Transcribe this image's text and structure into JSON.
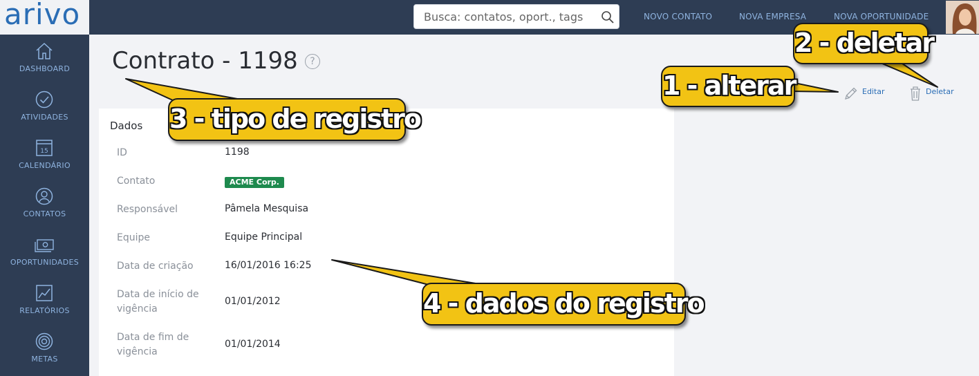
{
  "app": {
    "logo_text": "arivo"
  },
  "header": {
    "search_placeholder": "Busca: contatos, oport., tags",
    "links": [
      "NOVO CONTATO",
      "NOVA EMPRESA",
      "NOVA OPORTUNIDADE"
    ]
  },
  "sidebar": {
    "items": [
      {
        "label": "DASHBOARD",
        "icon": "home-icon"
      },
      {
        "label": "ATIVIDADES",
        "icon": "check-circle-icon"
      },
      {
        "label": "CALENDÁRIO",
        "icon": "calendar-icon",
        "day": "15"
      },
      {
        "label": "CONTATOS",
        "icon": "user-icon"
      },
      {
        "label": "OPORTUNIDADES",
        "icon": "money-icon"
      },
      {
        "label": "RELATÓRIOS",
        "icon": "chart-icon"
      },
      {
        "label": "METAS",
        "icon": "target-icon"
      }
    ]
  },
  "page": {
    "title": "Contrato - 1198",
    "help_icon": "?",
    "actions": {
      "edit_label": "Editar",
      "delete_label": "Deletar"
    }
  },
  "record": {
    "section_title": "Dados",
    "fields": [
      {
        "label": "ID",
        "value": "1198"
      },
      {
        "label": "Contato",
        "value": "ACME Corp."
      },
      {
        "label": "Responsável",
        "value": "Pâmela Mesquisa"
      },
      {
        "label": "Equipe",
        "value": "Equipe Principal"
      },
      {
        "label": "Data de criação",
        "value": "16/01/2016 16:25"
      },
      {
        "label": "Data de início de vigência",
        "value": "01/01/2012"
      },
      {
        "label": "Data de fim de vigência",
        "value": "01/01/2014"
      }
    ]
  },
  "annotations": [
    "1 - alterar",
    "2 - deletar",
    "3 - tipo de registro",
    "4 - dados do registro"
  ],
  "colors": {
    "sidebar_bg": "#2e3d54",
    "link": "#2a6db5",
    "badge": "#1e8a4e",
    "callout": "#f2c314"
  }
}
